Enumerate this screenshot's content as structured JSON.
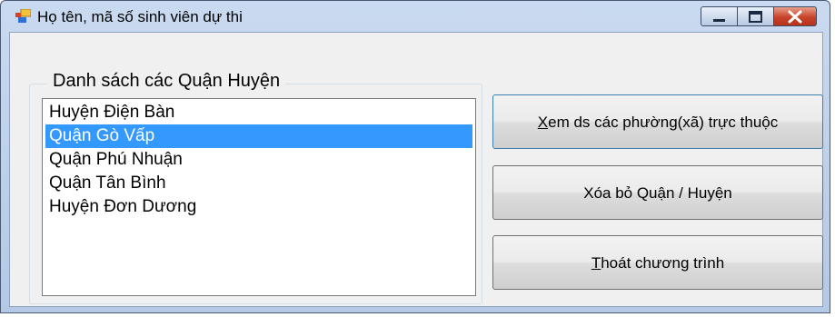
{
  "window": {
    "title": "Họ tên, mã số sinh viên dự thi"
  },
  "group": {
    "title": "Danh sách các Quận Huyện"
  },
  "listbox": {
    "items": [
      {
        "label": "Huyện Điện Bàn",
        "selected": false
      },
      {
        "label": "Quận Gò Vấp",
        "selected": true
      },
      {
        "label": "Quận Phú Nhuận",
        "selected": false
      },
      {
        "label": "Quận Tân Bình",
        "selected": false
      },
      {
        "label": "Huyện Đơn Dương",
        "selected": false
      }
    ]
  },
  "buttons": {
    "view": {
      "accel": "X",
      "rest": "em ds các phường(xã) trực thuộc"
    },
    "delete": {
      "label": "Xóa bỏ Quận / Huyện"
    },
    "exit": {
      "accel": "T",
      "rest": "hoát chương trình"
    }
  },
  "colors": {
    "selection": "#3399ff",
    "close_button": "#c7432a"
  },
  "icons": [
    "app-icon",
    "minimize-icon",
    "maximize-icon",
    "close-icon"
  ]
}
